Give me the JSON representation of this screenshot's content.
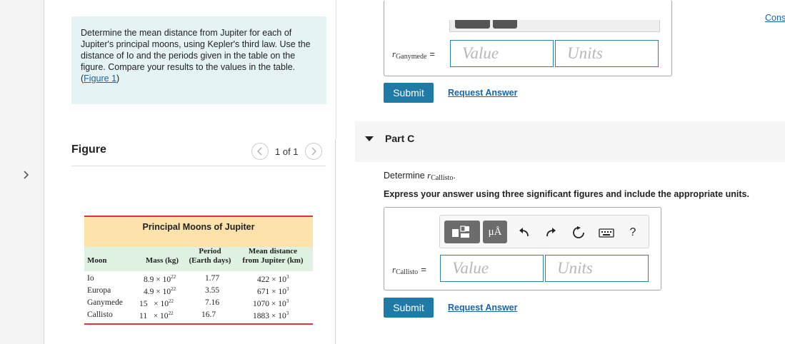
{
  "problem": {
    "text": "Determine the mean distance from Jupiter for each of Jupiter's principal moons, using Kepler's third law. Use the distance of Io and the periods given in the table on the figure. Compare your results to the values in the table.",
    "figure_link_open": "(",
    "figure_link": "Figure 1",
    "figure_link_close": ")"
  },
  "figure": {
    "title": "Figure",
    "counter": "1 of 1",
    "table_title": "Principal Moons of Jupiter",
    "columns": {
      "moon": "Moon",
      "mass": "Mass (kg)",
      "period_1": "Period",
      "period_2": "(Earth days)",
      "distance_1": "Mean distance",
      "distance_2": "from Jupiter (km)"
    },
    "rows": [
      {
        "moon": "Io",
        "mass_base": "8.9 × 10",
        "mass_exp": "22",
        "period": "1.77",
        "dist_base": "422 × 10",
        "dist_exp": "3"
      },
      {
        "moon": "Europa",
        "mass_base": "4.9 × 10",
        "mass_exp": "22",
        "period": "3.55",
        "dist_base": "671 × 10",
        "dist_exp": "3"
      },
      {
        "moon": "Ganymede",
        "mass_base": "15   × 10",
        "mass_exp": "22",
        "period": "7.16",
        "dist_base": "1070 × 10",
        "dist_exp": "3"
      },
      {
        "moon": "Callisto",
        "mass_base": "11   × 10",
        "mass_exp": "22",
        "period": "16.7",
        "dist_base": "1883 × 10",
        "dist_exp": "3"
      }
    ]
  },
  "header": {
    "constants_link": "Cons"
  },
  "part_b": {
    "var": "r",
    "sub": "Ganymede",
    "eq": "=",
    "value_placeholder": "Value",
    "units_placeholder": "Units",
    "submit": "Submit",
    "request": "Request Answer"
  },
  "part_c": {
    "title": "Part C",
    "determine_prefix": "Determine ",
    "determine_var": "r",
    "determine_sub": "Callisto",
    "determine_suffix": ".",
    "instructions": "Express your answer using three significant figures and include the appropriate units.",
    "var": "r",
    "sub": "Callisto",
    "eq": "=",
    "value_placeholder": "Value",
    "units_placeholder": "Units",
    "submit": "Submit",
    "request": "Request Answer",
    "toolbar": {
      "units_symbol": "μÅ",
      "help": "?"
    }
  }
}
